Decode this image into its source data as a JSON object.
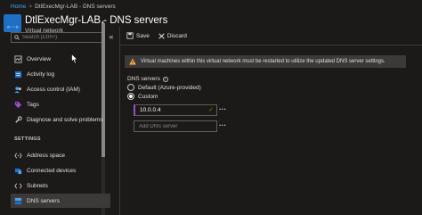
{
  "breadcrumb": {
    "home": "Home",
    "separator": ">",
    "current": "DtlExecMgr-LAB - DNS servers"
  },
  "header": {
    "title": "DtlExecMgr-LAB - DNS servers",
    "subtitle": "Virtual network",
    "icon": "virtual-network-icon"
  },
  "sidebar": {
    "search_placeholder": "Search (Ctrl+/)",
    "collapse": "«",
    "items": [
      {
        "label": "Overview",
        "icon": "overview-icon"
      },
      {
        "label": "Activity log",
        "icon": "activity-log-icon"
      },
      {
        "label": "Access control (IAM)",
        "icon": "iam-icon"
      },
      {
        "label": "Tags",
        "icon": "tag-icon"
      },
      {
        "label": "Diagnose and solve problems",
        "icon": "wrench-icon"
      }
    ],
    "settings_header": "SETTINGS",
    "settings_items": [
      {
        "label": "Address space",
        "icon": "address-space-icon"
      },
      {
        "label": "Connected devices",
        "icon": "connected-devices-icon"
      },
      {
        "label": "Subnets",
        "icon": "subnets-icon"
      },
      {
        "label": "DNS servers",
        "icon": "dns-icon",
        "active": true
      }
    ]
  },
  "toolbar": {
    "save_label": "Save",
    "discard_label": "Discard"
  },
  "main": {
    "warning": "Virtual machines within this virtual network must be restarted to utilize the updated DNS server settings.",
    "dns_label": "DNS servers",
    "options": [
      {
        "label": "Default (Azure-provided)",
        "checked": false
      },
      {
        "label": "Custom",
        "checked": true
      }
    ],
    "dns_entries": [
      "10.0.0.4"
    ],
    "add_placeholder": "Add DNS server",
    "more": "..."
  },
  "colors": {
    "accent": "#9b4dca",
    "link": "#4aa2f0",
    "valid": "#57a300",
    "warning": "#ffaa44"
  }
}
